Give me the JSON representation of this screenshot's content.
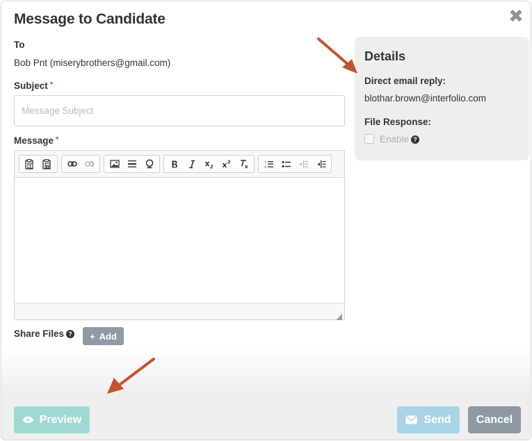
{
  "modal": {
    "title": "Message to Candidate",
    "close_glyph": "✖"
  },
  "to": {
    "label": "To",
    "value": "Bob Pnt (miserybrothers@gmail.com)"
  },
  "subject": {
    "label": "Subject",
    "required_mark": "*",
    "placeholder": "Message Subject",
    "value": ""
  },
  "message": {
    "label": "Message",
    "required_mark": "*",
    "toolbar": [
      [
        "paste-text-icon",
        "paste-word-icon"
      ],
      [
        "link-icon",
        "unlink-icon"
      ],
      [
        "image-icon",
        "horizontal-line-icon",
        "special-char-icon"
      ],
      [
        "bold-icon",
        "italic-icon",
        "subscript-icon",
        "superscript-icon",
        "remove-format-icon"
      ],
      [
        "numbered-list-icon",
        "bulleted-list-icon",
        "outdent-icon",
        "indent-icon"
      ]
    ]
  },
  "share_files": {
    "label": "Share Files",
    "help": "?",
    "add_label": "Add",
    "add_glyph": "+"
  },
  "details": {
    "title": "Details",
    "direct_reply_label": "Direct email reply:",
    "direct_reply_value": "blothar.brown@interfolio.com",
    "file_response_label": "File Response:",
    "enable_label": "Enable",
    "enable_checked": false,
    "help": "?"
  },
  "footer": {
    "preview_label": "Preview",
    "send_label": "Send",
    "cancel_label": "Cancel"
  },
  "colors": {
    "preview": "#9fdad2",
    "send": "#a9d3e6",
    "cancel": "#8f99a3",
    "add": "#8e9aa5",
    "required": "#e0412b",
    "annotation_arrow": "#c4532e"
  }
}
